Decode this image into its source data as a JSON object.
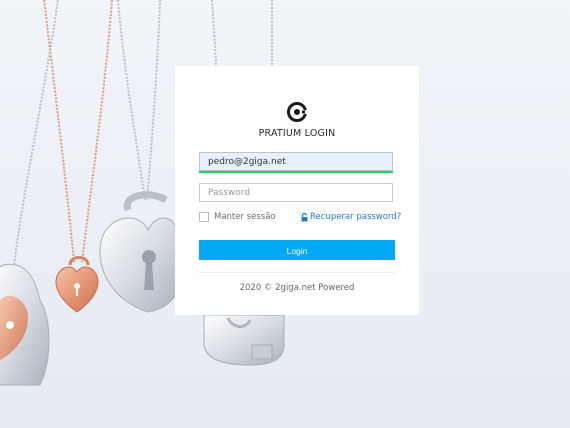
{
  "login": {
    "title": "PRATIUM LOGIN",
    "email_value": "pedro@2giga.net",
    "password_placeholder": "Password",
    "remember_label": "Manter sessão",
    "recover_label": "Recuperar password?",
    "submit_label": "Login",
    "footer": "2020 © 2giga.net Powered"
  },
  "colors": {
    "accent": "#03a9f4",
    "valid": "#2ecc5a",
    "link": "#2a7bd0"
  },
  "icons": {
    "brand": "pratium-logo-icon",
    "recover": "unlock-icon"
  }
}
